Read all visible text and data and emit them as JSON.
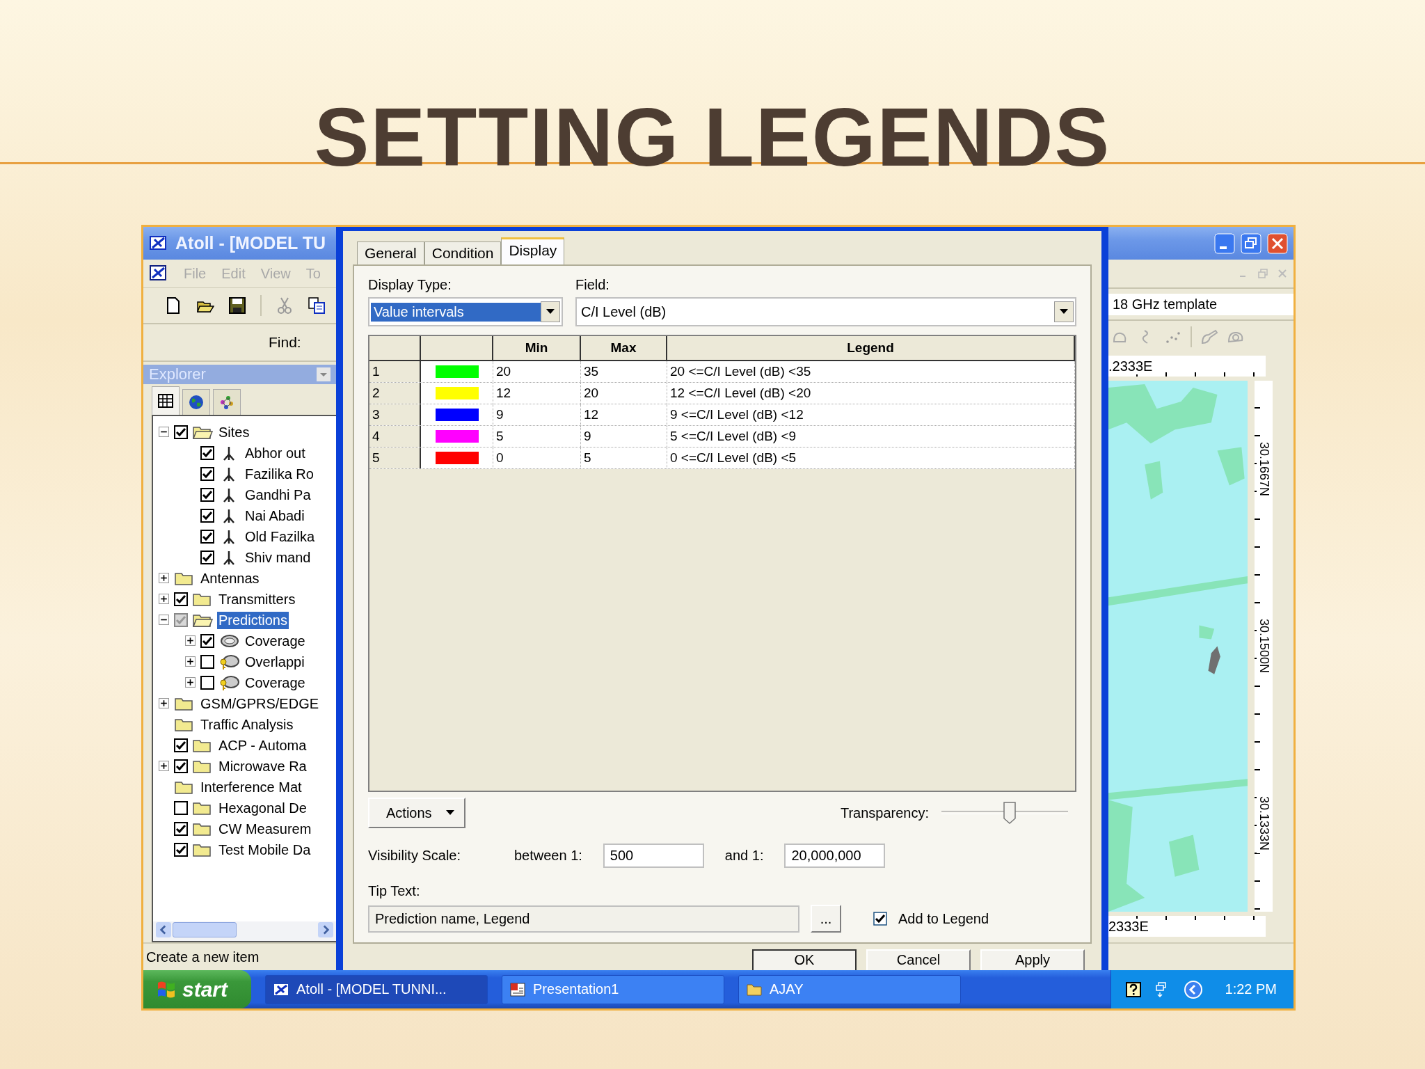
{
  "slide": {
    "title": "SETTING LEGENDS"
  },
  "main_window": {
    "title": "Atoll - [MODEL TU",
    "menu": [
      "File",
      "Edit",
      "View",
      "To"
    ],
    "find_label": "Find:",
    "explorer": {
      "title": "Explorer",
      "tree": [
        {
          "label": "Sites",
          "kind": "folder",
          "expanded": true,
          "checked": true,
          "greyed": false,
          "selected": false,
          "children": [
            {
              "label": "Abhor out",
              "kind": "site",
              "checked": true,
              "greyed": false,
              "selected": false
            },
            {
              "label": "Fazilika Ro",
              "kind": "site",
              "checked": true,
              "greyed": false,
              "selected": false
            },
            {
              "label": "Gandhi Pa",
              "kind": "site",
              "checked": true,
              "greyed": false,
              "selected": false
            },
            {
              "label": "Nai Abadi",
              "kind": "site",
              "checked": true,
              "greyed": false,
              "selected": false
            },
            {
              "label": "Old Fazilka",
              "kind": "site",
              "checked": true,
              "greyed": false,
              "selected": false
            },
            {
              "label": "Shiv mand",
              "kind": "site",
              "checked": true,
              "greyed": false,
              "selected": false
            }
          ]
        },
        {
          "label": "Antennas",
          "kind": "folder",
          "expanded": false,
          "selected": false
        },
        {
          "label": "Transmitters",
          "kind": "folder",
          "expanded": false,
          "checked": true,
          "greyed": false,
          "selected": false
        },
        {
          "label": "Predictions",
          "kind": "folder",
          "expanded": true,
          "checked": true,
          "greyed": true,
          "selected": true,
          "children": [
            {
              "label": "Coverage",
              "kind": "prediction",
              "expanded": false,
              "checked": true,
              "greyed": false,
              "selected": false
            },
            {
              "label": "Overlappi",
              "kind": "locked-prediction",
              "expanded": false,
              "checked": false,
              "greyed": false,
              "selected": false
            },
            {
              "label": "Coverage",
              "kind": "locked-prediction",
              "expanded": false,
              "checked": false,
              "greyed": false,
              "selected": false
            }
          ]
        },
        {
          "label": "GSM/GPRS/EDGE",
          "kind": "folder",
          "expanded": false,
          "selected": false
        },
        {
          "label": "Traffic Analysis",
          "kind": "folder",
          "selected": false
        },
        {
          "label": "ACP - Automa",
          "kind": "folder",
          "checked": true,
          "greyed": false,
          "selected": false
        },
        {
          "label": "Microwave Ra",
          "kind": "folder",
          "expanded": false,
          "checked": true,
          "greyed": false,
          "selected": false
        },
        {
          "label": "Interference Mat",
          "kind": "folder",
          "selected": false
        },
        {
          "label": "Hexagonal De",
          "kind": "folder",
          "checked": false,
          "greyed": false,
          "selected": false
        },
        {
          "label": "CW Measurem",
          "kind": "folder",
          "checked": true,
          "greyed": false,
          "selected": false
        },
        {
          "label": "Test Mobile Da",
          "kind": "folder",
          "checked": true,
          "greyed": false,
          "selected": false
        }
      ]
    },
    "status_bar": "Create a new item",
    "template": "18 GHz template",
    "map": {
      "top_ruler": ".2333E",
      "bottom_ruler": "2333E",
      "latitudes": [
        "30.1667N",
        "30.1500N",
        "30.1333N"
      ]
    }
  },
  "dialog": {
    "tabs": [
      {
        "label": "General",
        "selected": false
      },
      {
        "label": "Condition",
        "selected": false
      },
      {
        "label": "Display",
        "selected": true
      }
    ],
    "display_type_label": "Display Type:",
    "display_type": "Value intervals",
    "field_label": "Field:",
    "field": "C/I Level (dB)",
    "legend_table": {
      "columns": [
        "Min",
        "Max",
        "Legend"
      ],
      "rows": [
        {
          "index": "1",
          "color": "#00ff00",
          "min": "20",
          "max": "35",
          "legend": "20 <=C/I Level (dB) <35"
        },
        {
          "index": "2",
          "color": "#ffff00",
          "min": "12",
          "max": "20",
          "legend": "12 <=C/I Level (dB) <20"
        },
        {
          "index": "3",
          "color": "#0000ff",
          "min": "9",
          "max": "12",
          "legend": "9 <=C/I Level (dB) <12"
        },
        {
          "index": "4",
          "color": "#ff00ff",
          "min": "5",
          "max": "9",
          "legend": "5 <=C/I Level (dB) <9"
        },
        {
          "index": "5",
          "color": "#ff0000",
          "min": "0",
          "max": "5",
          "legend": "0 <=C/I Level (dB) <5"
        }
      ]
    },
    "actions_button": "Actions",
    "transparency_label": "Transparency:",
    "transparency": {
      "level": 0.54
    },
    "visibility_label": "Visibility Scale:",
    "between_label": "between 1:",
    "between_value": "500",
    "and_label": "and 1:",
    "and_value": "20,000,000",
    "tip_label": "Tip Text:",
    "tip_text": "Prediction name, Legend",
    "browse_button": "...",
    "add_to_legend": {
      "label": "Add to Legend",
      "checked": true
    },
    "buttons": [
      "OK",
      "Cancel",
      "Apply"
    ]
  },
  "taskbar": {
    "start": "start",
    "tasks": [
      {
        "label": "Atoll - [MODEL TUNNI...",
        "kind": "app",
        "selected": true
      },
      {
        "label": "Presentation1",
        "kind": "presentation",
        "selected": false
      },
      {
        "label": "AJAY",
        "kind": "folder",
        "selected": false
      }
    ],
    "clock": "1:22 PM"
  }
}
